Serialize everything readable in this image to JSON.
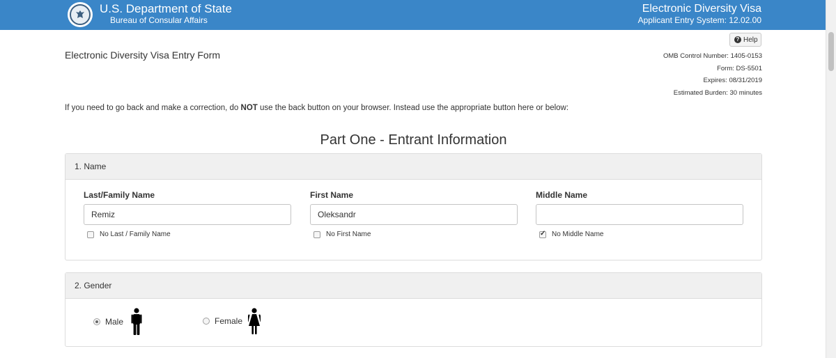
{
  "header": {
    "department": "U.S. Department of State",
    "bureau": "Bureau of Consular Affairs",
    "system_title": "Electronic Diversity Visa",
    "system_version": "Applicant Entry System: 12.02.00",
    "seal_icon": "state-department-seal-icon",
    "color": "#3a86c8"
  },
  "help": {
    "label": "Help",
    "icon": "question-circle-icon"
  },
  "form": {
    "title": "Electronic Diversity Visa Entry Form",
    "meta": {
      "omb": "OMB Control Number: 1405-0153",
      "form": "Form: DS-5501",
      "expires": "Expires: 08/31/2019",
      "burden": "Estimated Burden: 30 minutes"
    },
    "instructions": {
      "before": "If you need to go back and make a correction, do ",
      "emphasis": "NOT",
      "after": " use the back button on your browser. Instead use the appropriate button here or below:"
    },
    "part_heading": "Part One - Entrant Information"
  },
  "name_section": {
    "heading": "1. Name",
    "last": {
      "label": "Last/Family Name",
      "value": "Remiz",
      "no_label": "No Last / Family Name",
      "no_checked": false
    },
    "first": {
      "label": "First Name",
      "value": "Oleksandr",
      "no_label": "No First Name",
      "no_checked": false
    },
    "middle": {
      "label": "Middle Name",
      "value": "",
      "no_label": "No Middle Name",
      "no_checked": true
    }
  },
  "gender_section": {
    "heading": "2. Gender",
    "male": {
      "label": "Male",
      "selected": true,
      "icon": "male-figure-icon"
    },
    "female": {
      "label": "Female",
      "selected": false,
      "icon": "female-figure-icon"
    }
  }
}
